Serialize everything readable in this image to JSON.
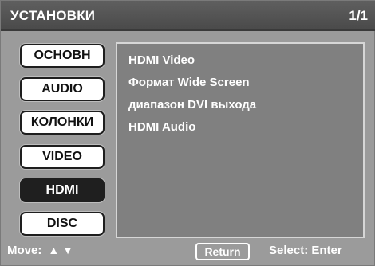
{
  "header": {
    "title": "УСТАНОВКИ",
    "page_indicator": "1/1"
  },
  "tabs": [
    {
      "label": "ОСНОВН",
      "active": false
    },
    {
      "label": "AUDIO",
      "active": false
    },
    {
      "label": "КОЛОНКИ",
      "active": false
    },
    {
      "label": "VIDEO",
      "active": false
    },
    {
      "label": "HDMI",
      "active": true
    },
    {
      "label": "DISC",
      "active": false
    }
  ],
  "menu_items": [
    "HDMI Video",
    "Формат Wide Screen",
    "диапазон DVI выхода",
    "HDMI Audio"
  ],
  "footer": {
    "move_label": "Move:",
    "move_arrows": "▲ ▼",
    "return_label": "Return",
    "select_label": "Select: Enter"
  },
  "colors": {
    "background": "#9b9b9b",
    "header": "#4a4a4a",
    "panel": "#808080",
    "active_tab": "#1f1f1f"
  }
}
